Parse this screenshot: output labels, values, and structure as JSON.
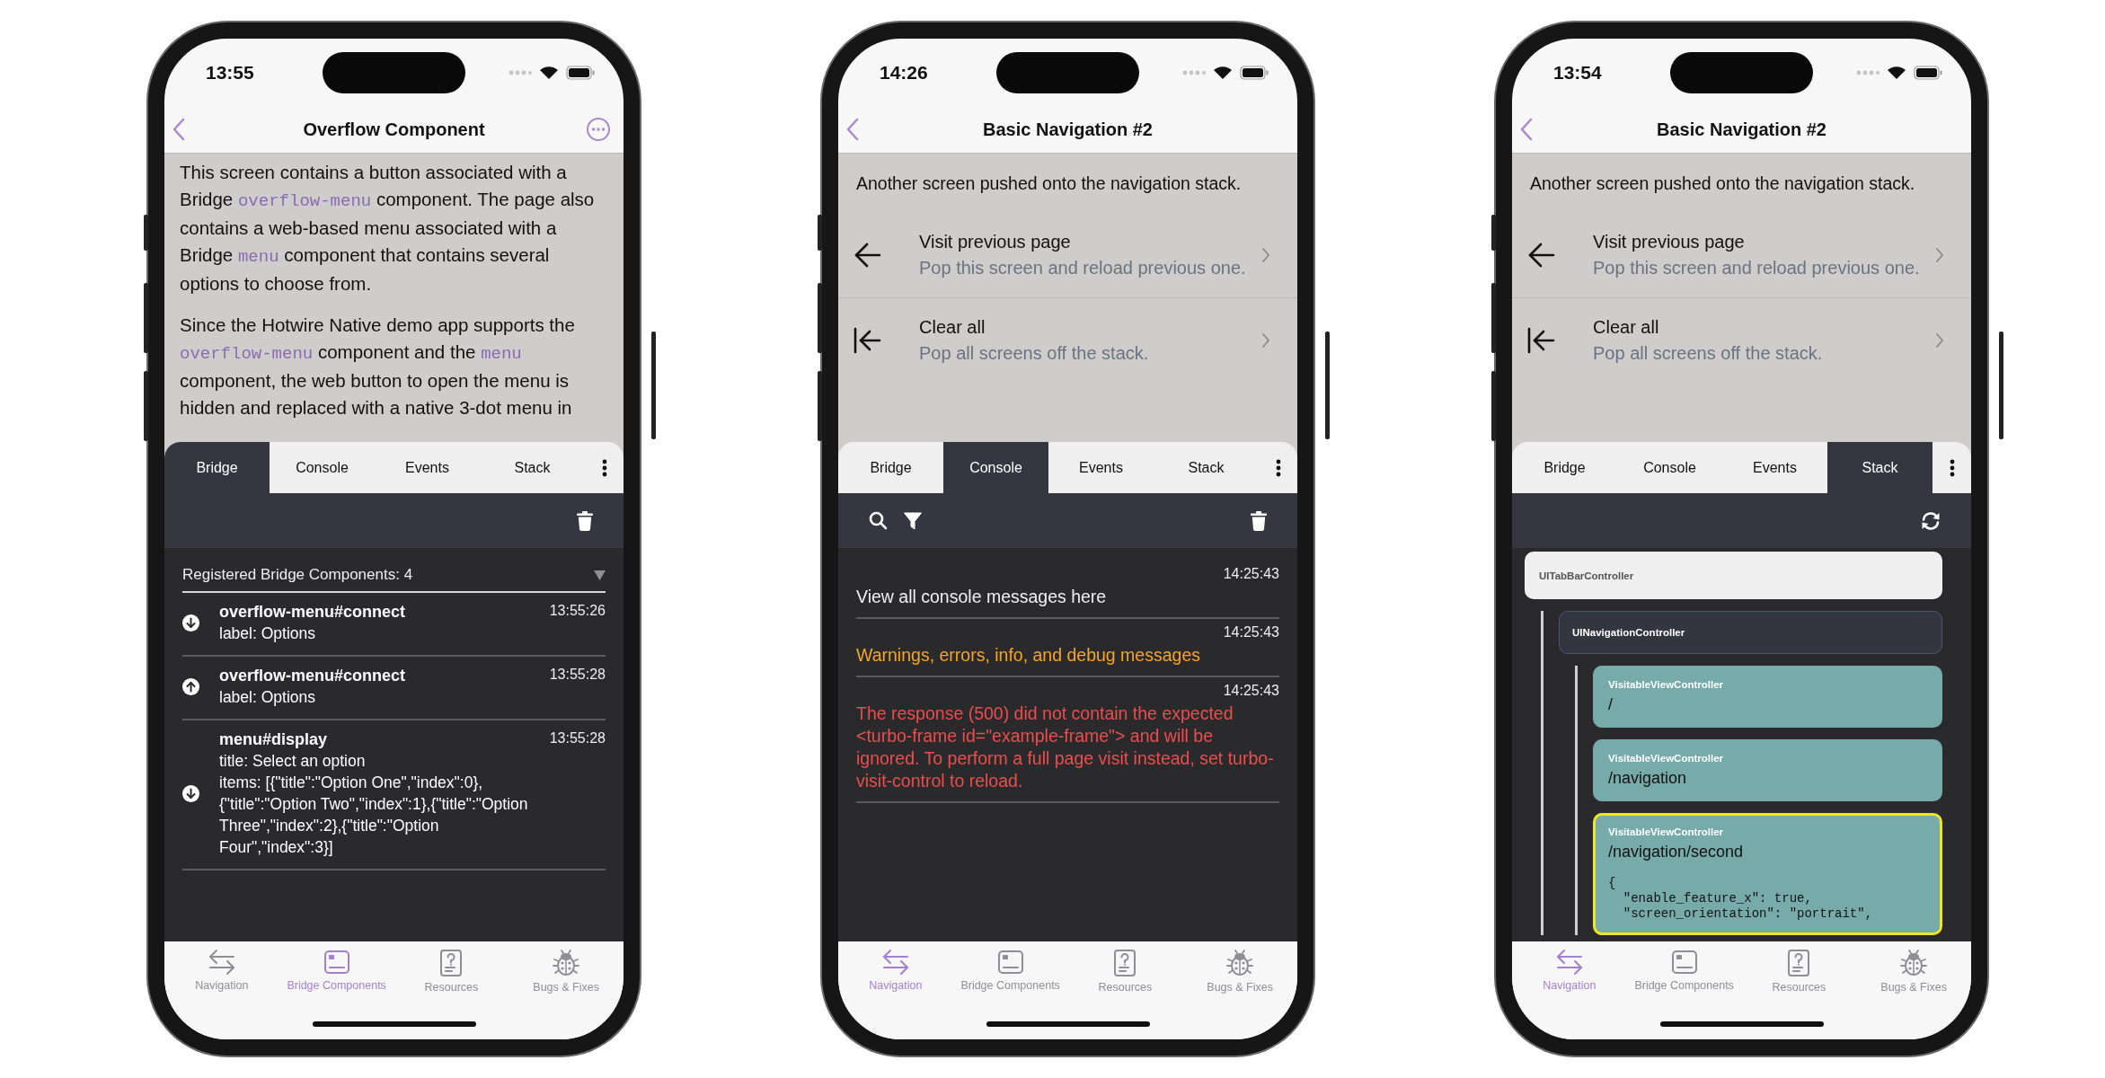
{
  "phones": [
    {
      "status_bar": {
        "time": "13:55"
      },
      "nav_bar": {
        "title": "Overflow Component",
        "menu_button": true
      },
      "content": {
        "kind": "article",
        "paragraphs": [
          [
            {
              "text": "This screen contains a button associated with a Bridge ",
              "code": false
            },
            {
              "text": "overflow-menu",
              "code": true
            },
            {
              "text": " component. The page also contains a web-based menu associated with a Bridge ",
              "code": false
            },
            {
              "text": "menu",
              "code": true
            },
            {
              "text": " component that contains several options to choose from.",
              "code": false
            }
          ],
          [
            {
              "text": "Since the Hotwire Native demo app supports the ",
              "code": false
            },
            {
              "text": "overflow-menu",
              "code": true
            },
            {
              "text": " component and the ",
              "code": false
            },
            {
              "text": "menu",
              "code": true
            },
            {
              "text": " component, the web button to open the menu is hidden and replaced with a native 3-dot menu in",
              "code": false
            }
          ]
        ]
      },
      "debug_panel": {
        "tabs": [
          {
            "label": "Bridge",
            "selected": true
          },
          {
            "label": "Console",
            "selected": false
          },
          {
            "label": "Events",
            "selected": false
          },
          {
            "label": "Stack",
            "selected": false
          }
        ],
        "tools": [
          {
            "kind": "trash"
          }
        ],
        "view": {
          "kind": "bridge",
          "header": "Registered Bridge Components: 4",
          "messages": [
            {
              "kind": "incoming",
              "title": "overflow-menu#connect",
              "time": "13:55:26",
              "lines": [
                "label: Options"
              ]
            },
            {
              "kind": "outgoing",
              "title": "overflow-menu#connect",
              "time": "13:55:28",
              "lines": [
                "label: Options"
              ]
            },
            {
              "kind": "incoming",
              "title": "menu#display",
              "time": "13:55:28",
              "lines": [
                "title: Select an option",
                "items: [{\"title\":\"Option One\",\"index\":0},{\"title\":\"Option Two\",\"index\":1},{\"title\":\"Option Three\",\"index\":2},{\"title\":\"Option Four\",\"index\":3}]"
              ]
            }
          ]
        }
      },
      "tab_bar": [
        {
          "label": "Navigation",
          "selected": false
        },
        {
          "label": "Bridge Components",
          "selected": true
        },
        {
          "label": "Resources",
          "selected": false
        },
        {
          "label": "Bugs & Fixes",
          "selected": false
        }
      ]
    },
    {
      "status_bar": {
        "time": "14:26"
      },
      "nav_bar": {
        "title": "Basic Navigation #2"
      },
      "content": {
        "kind": "actions",
        "intro": "Another screen pushed onto the navigation stack.",
        "rows": [
          {
            "kind": "back",
            "title": "Visit previous page",
            "subtitle": "Pop this screen and reload previous one."
          },
          {
            "kind": "clear",
            "title": "Clear all",
            "subtitle": "Pop all screens off the stack."
          }
        ]
      },
      "debug_panel": {
        "tabs": [
          {
            "label": "Bridge",
            "selected": false
          },
          {
            "label": "Console",
            "selected": true
          },
          {
            "label": "Events",
            "selected": false
          },
          {
            "label": "Stack",
            "selected": false
          }
        ],
        "tools": [
          {
            "kind": "search"
          },
          {
            "kind": "filter"
          },
          {
            "kind": "trash"
          }
        ],
        "view": {
          "kind": "console",
          "entries": [
            {
              "kind": "log",
              "time": "14:25:43",
              "message": "View all console messages here"
            },
            {
              "kind": "warning",
              "time": "14:25:43",
              "message": "Warnings, errors, info, and debug messages"
            },
            {
              "kind": "error",
              "time": "14:25:43",
              "message": "The response (500) did not contain the expected <turbo-frame id=\"example-frame\"> and will be ignored. To perform a full page visit instead, set turbo-visit-control to reload."
            }
          ]
        }
      },
      "tab_bar": [
        {
          "label": "Navigation",
          "selected": true
        },
        {
          "label": "Bridge Components",
          "selected": false
        },
        {
          "label": "Resources",
          "selected": false
        },
        {
          "label": "Bugs & Fixes",
          "selected": false
        }
      ]
    },
    {
      "status_bar": {
        "time": "13:54"
      },
      "nav_bar": {
        "title": "Basic Navigation #2"
      },
      "content": {
        "kind": "actions",
        "intro": "Another screen pushed onto the navigation stack.",
        "rows": [
          {
            "kind": "back",
            "title": "Visit previous page",
            "subtitle": "Pop this screen and reload previous one."
          },
          {
            "kind": "clear",
            "title": "Clear all",
            "subtitle": "Pop all screens off the stack."
          }
        ]
      },
      "debug_panel": {
        "tabs": [
          {
            "label": "Bridge",
            "selected": false
          },
          {
            "label": "Console",
            "selected": false
          },
          {
            "label": "Events",
            "selected": false
          },
          {
            "label": "Stack",
            "selected": true
          }
        ],
        "tools": [
          {
            "kind": "refresh"
          }
        ],
        "view": {
          "kind": "stack",
          "nodes": [
            {
              "name": "UITabBarController",
              "selected": false,
              "children": [
                {
                  "name": "UINavigationController",
                  "selected": false,
                  "children": [
                    {
                      "name": "VisitableViewController",
                      "path": "/",
                      "selected": false
                    },
                    {
                      "name": "VisitableViewController",
                      "path": "/navigation",
                      "selected": false
                    },
                    {
                      "name": "VisitableViewController",
                      "path": "/navigation/second",
                      "selected": true,
                      "properties": [
                        "{",
                        "  \"enable_feature_x\": true,",
                        "  \"screen_orientation\": \"portrait\","
                      ]
                    }
                  ]
                }
              ]
            }
          ]
        }
      },
      "tab_bar": [
        {
          "label": "Navigation",
          "selected": true
        },
        {
          "label": "Bridge Components",
          "selected": false
        },
        {
          "label": "Resources",
          "selected": false
        },
        {
          "label": "Bugs & Fixes",
          "selected": false
        }
      ]
    }
  ]
}
